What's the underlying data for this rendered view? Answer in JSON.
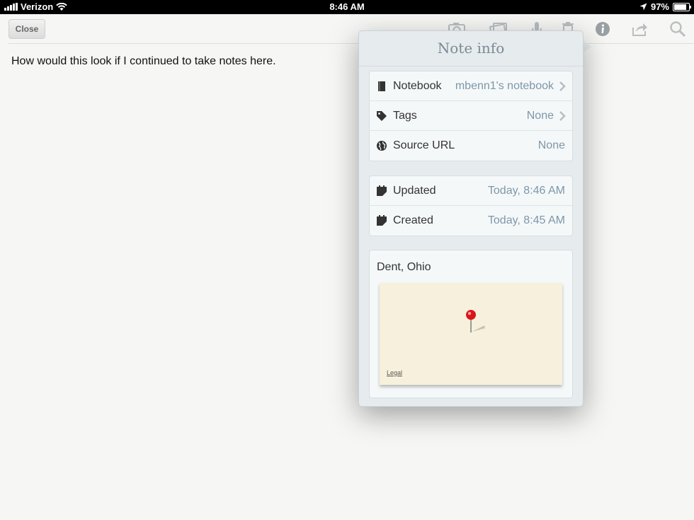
{
  "status_bar": {
    "carrier": "Verizon",
    "time": "8:46 AM",
    "battery": "97%",
    "battery_level": 0.97
  },
  "toolbar": {
    "close_label": "Close",
    "icons": [
      "camera-icon",
      "snapshot-icon",
      "microphone-icon",
      "trash-icon",
      "info-icon",
      "share-icon",
      "search-icon"
    ]
  },
  "note": {
    "body": "How would this look if I continued to take notes here."
  },
  "popover": {
    "title": "Note info",
    "details": {
      "notebook": {
        "label": "Notebook",
        "value": "mbenn1's notebook"
      },
      "tags": {
        "label": "Tags",
        "value": "None"
      },
      "source_url": {
        "label": "Source URL",
        "value": "None"
      }
    },
    "dates": {
      "updated": {
        "label": "Updated",
        "value": "Today, 8:46 AM"
      },
      "created": {
        "label": "Created",
        "value": "Today, 8:45 AM"
      }
    },
    "location": {
      "name": "Dent, Ohio",
      "map_legal": "Legal"
    }
  },
  "colors": {
    "accent_value": "#7d97a9",
    "popover_bg": "#e6ebee",
    "pin_red": "#d9151b"
  }
}
